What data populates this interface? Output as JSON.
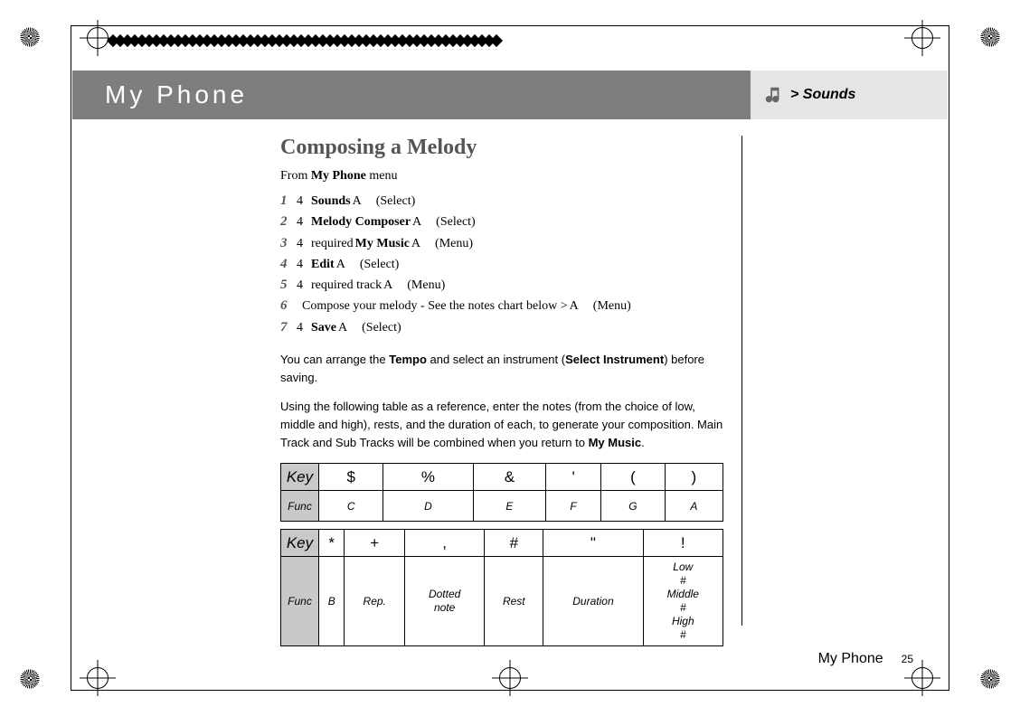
{
  "header": {
    "section": "My Phone",
    "breadcrumb": "> Sounds",
    "icon": "music-notes-icon"
  },
  "content": {
    "heading": "Composing a Melody",
    "from_prefix": "From ",
    "from_menu": "My Phone",
    "from_suffix": " menu",
    "steps": [
      {
        "num": "1",
        "sel": "4",
        "bold": "Sounds",
        "sym": "A",
        "paren": "(Select)"
      },
      {
        "num": "2",
        "sel": "4",
        "bold": "Melody Composer",
        "sym": "A",
        "paren": "(Select)"
      },
      {
        "num": "3",
        "sel": "4",
        "pre": "required ",
        "bold": "My Music",
        "sym": "A",
        "paren": "(Menu)"
      },
      {
        "num": "4",
        "sel": "4",
        "bold": "Edit",
        "sym": "A",
        "paren": "(Select)"
      },
      {
        "num": "5",
        "sel": "4",
        "pre": "required track",
        "sym": "A",
        "paren": "(Menu)"
      },
      {
        "num": "6",
        "compose": "Compose your melody - See the notes chart below >",
        "sym": "A",
        "paren": "(Menu)"
      },
      {
        "num": "7",
        "sel": "4",
        "bold": "Save",
        "sym": "A",
        "paren": "(Select)"
      }
    ],
    "para1_a": "You can arrange the ",
    "para1_b": "Tempo",
    "para1_c": " and select an instrument (",
    "para1_d": "Select Instrument",
    "para1_e": ") before saving.",
    "para2_a": "Using the following table as a reference, enter the notes (from the choice of low, middle and high), rests, and the duration of each, to generate your composition. Main Track and Sub Tracks will be combined when you return to ",
    "para2_b": "My Music",
    "para2_c": "."
  },
  "chart_data": [
    {
      "type": "table",
      "title": "Key/Function map 1",
      "rows": [
        {
          "label": "Key",
          "cells": [
            "$",
            "%",
            "&",
            "'",
            "(",
            ")"
          ]
        },
        {
          "label": "Func",
          "cells": [
            "C",
            "D",
            "E",
            "F",
            "G",
            "A"
          ]
        }
      ]
    },
    {
      "type": "table",
      "title": "Key/Function map 2",
      "rows": [
        {
          "label": "Key",
          "cells": [
            "*",
            "+",
            ",",
            "#",
            "\"",
            "!"
          ]
        },
        {
          "label": "Func",
          "cells": [
            "B",
            "Rep.",
            "Dotted note",
            "Rest",
            "Duration",
            "Low # Middle # High #"
          ]
        }
      ]
    }
  ],
  "footer": {
    "section": "My Phone",
    "page": "25"
  }
}
